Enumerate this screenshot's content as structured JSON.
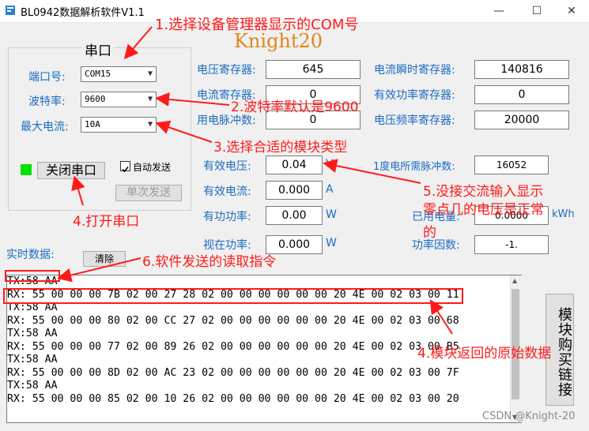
{
  "window": {
    "title": "BL0942数据解析软件V1.1",
    "minimize": "—",
    "maximize": "☐",
    "close": "✕"
  },
  "watermark": "Knight20",
  "serial": {
    "group_title": "串口",
    "port_label": "端口号:",
    "port_value": "COM15",
    "baud_label": "波特率:",
    "baud_value": "9600",
    "current_label": "最大电流:",
    "current_value": "10A",
    "close_button": "关闭串口",
    "auto_send_label": "自动发送",
    "single_send_button": "单次发送",
    "status_color": "#00e000"
  },
  "registers": {
    "voltage_reg_label": "电压寄存器:",
    "voltage_reg_value": "645",
    "current_reg_label": "电流寄存器:",
    "current_reg_value": "0",
    "pulse_label": "用电脉冲数:",
    "pulse_value": "0",
    "inst_current_reg_label": "电流瞬时寄存器:",
    "inst_current_reg_value": "140816",
    "active_power_reg_label": "有效功率寄存器:",
    "active_power_reg_value": "0",
    "freq_reg_label": "电压频率寄存器:",
    "freq_reg_value": "20000"
  },
  "measurements": {
    "rms_voltage_label": "有效电压:",
    "rms_voltage_value": "0.04",
    "rms_voltage_unit": "V",
    "rms_current_label": "有效电流:",
    "rms_current_value": "0.000",
    "rms_current_unit": "A",
    "active_power_label": "有功功率:",
    "active_power_value": "0.00",
    "active_power_unit": "W",
    "apparent_power_label": "视在功率:",
    "apparent_power_value": "0.000",
    "apparent_power_unit": "W",
    "pulses_per_kwh_label": "1度电所需脉冲数:",
    "pulses_per_kwh_value": "16052",
    "used_energy_label": "已用电量:",
    "used_energy_value": "0.0000",
    "used_energy_unit": "kWh",
    "power_factor_label": "功率因数:",
    "power_factor_value": "-1."
  },
  "realtime": {
    "label": "实时数据:",
    "clear_button": "清除"
  },
  "log_lines": [
    "TX:58 AA",
    "RX: 55 00 00 00 7B 02 00 27 28 02 00 00 00 00 00 00 20 4E 00 02 03 00 11",
    "TX:58 AA",
    "RX: 55 00 00 00 80 02 00 CC 27 02 00 00 00 00 00 00 20 4E 00 02 03 00 68",
    "TX:58 AA",
    "RX: 55 00 00 00 77 02 00 89 26 02 00 00 00 00 00 00 20 4E 00 02 03 00 B5",
    "TX:58 AA",
    "RX: 55 00 00 00 8D 02 00 AC 23 02 00 00 00 00 00 00 20 4E 00 02 03 00 7F",
    "TX:58 AA",
    "RX: 55 00 00 00 85 02 00 10 26 02 00 00 00 00 00 00 20 4E 00 02 03 00 20"
  ],
  "purchase_button": "模块购买链接",
  "annotations": {
    "a1": "1.选择设备管理器显示的COM号",
    "a2": "2.波特率默认是9600",
    "a3": "3.选择合适的模块类型",
    "a4": "4.打开串口",
    "a5_line1": "5.没接交流输入显示",
    "a5_line2": "零点几的电压是正常",
    "a5_line3": "的",
    "a6": "6.软件发送的读取指令",
    "a7": "4.模块返回的原始数据",
    "arrow_color": "#ff1a1a"
  },
  "credit": "CSDN @Knight-20"
}
